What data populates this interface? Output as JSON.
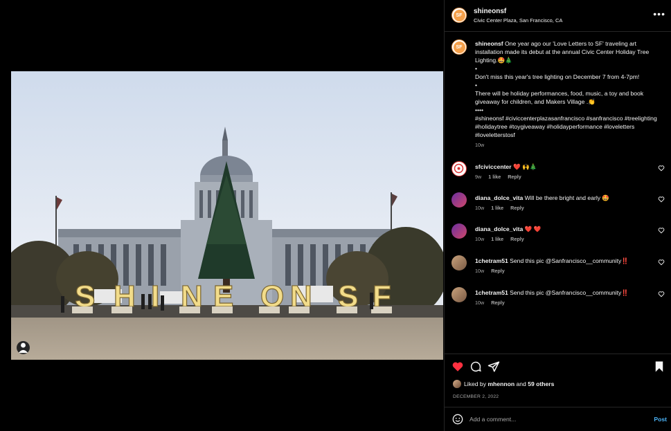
{
  "post": {
    "username": "shineonsf",
    "location": "Civic Center Plaza, San Francisco, CA",
    "avatar_text": "SF",
    "more_icon": "more-dots-icon"
  },
  "photo": {
    "sign_letters": [
      "S",
      "H",
      "I",
      "N",
      "E",
      "O",
      "N",
      "S",
      "F"
    ],
    "tag_icon": "user-tag-icon"
  },
  "caption": {
    "username": "shineonsf",
    "text1": "One year ago our 'Love Letters to SF' traveling art installation made its debut at the annual Civic Center Holiday Tree Lighting.🤩🎄",
    "sep1": "•",
    "text2": "Don't miss this year's tree lighting on December 7 from 4-7pm!",
    "sep2": "•",
    "text3": "There will be holiday performances, food, music, a toy and book giveaway for children, and Makers Village .👏",
    "sep3": "••••",
    "hashtags": "#shineonsf #civiccenterplazasanfrancisco #sanfrancisco #treelighting #holidaytree #toygiveaway #holidayperformance #loveletters #loveletterstosf",
    "time": "10w"
  },
  "comments": [
    {
      "username": "sfciviccenter",
      "text": "❤️ 🙌🎄",
      "time": "9w",
      "likes": "1 like",
      "reply": "Reply"
    },
    {
      "username": "diana_dolce_vita",
      "text": "Will be there bright and early 🤩",
      "time": "10w",
      "likes": "1 like",
      "reply": "Reply"
    },
    {
      "username": "diana_dolce_vita",
      "text": "❤️ ❤️",
      "time": "10w",
      "likes": "1 like",
      "reply": "Reply"
    },
    {
      "username": "1chetram51",
      "text": "Send this pic @Sanfrancisco__community‼️",
      "time": "10w",
      "likes": "",
      "reply": "Reply"
    },
    {
      "username": "1chetram51",
      "text": "Send this pic @Sanfrancisco__community‼️",
      "time": "10w",
      "likes": "",
      "reply": "Reply"
    }
  ],
  "actions": {
    "like_icon": "heart-filled-icon",
    "comment_icon": "comment-bubble-icon",
    "share_icon": "paper-plane-icon",
    "save_icon": "bookmark-icon",
    "liked_by_prefix": "Liked by",
    "liked_by_user": "mhennon",
    "liked_by_suffix": "and",
    "liked_by_others": "59 others",
    "date": "DECEMBER 2, 2022"
  },
  "add_comment": {
    "placeholder": "Add a comment...",
    "post_label": "Post",
    "emoji_icon": "emoji-smile-icon"
  },
  "colors": {
    "background": "#000000",
    "text": "#f5f5f5",
    "secondary_text": "#a8a8a8",
    "like_red": "#ff3040",
    "link_blue": "#4cb5f9",
    "divider": "#262626"
  }
}
